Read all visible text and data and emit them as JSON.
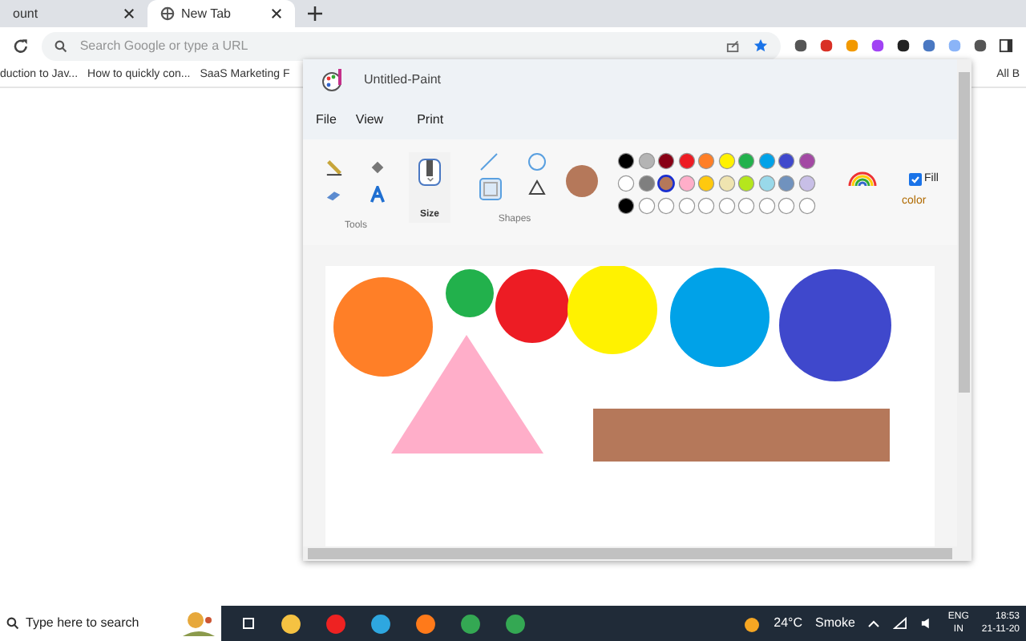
{
  "tabs": [
    {
      "label": "ount",
      "selected": false
    },
    {
      "label": "New Tab",
      "selected": true
    }
  ],
  "address_bar": {
    "placeholder": "Search Google or type a URL"
  },
  "bookmarks": [
    "duction to Jav...",
    "How to quickly con...",
    "SaaS Marketing F",
    "All B"
  ],
  "popup": {
    "title": "Untitled-Paint",
    "menu": [
      "File",
      "View",
      "Print"
    ],
    "groups": [
      "Tools",
      "Size",
      "Shapes"
    ],
    "palette": [
      [
        {
          "color": "#000000",
          "selected": false
        },
        {
          "color": "#b4b4b4",
          "selected": false
        },
        {
          "color": "#880015",
          "selected": false
        },
        {
          "color": "#ed1c24",
          "selected": false
        },
        {
          "color": "#ff7f27",
          "selected": false
        },
        {
          "color": "#fff200",
          "selected": false
        },
        {
          "color": "#22b14c",
          "selected": false
        },
        {
          "color": "#00a2e8",
          "selected": false
        },
        {
          "color": "#3f48cc",
          "selected": false
        },
        {
          "color": "#a349a4",
          "selected": false
        }
      ],
      [
        {
          "color": "#ffffff",
          "selected": false
        },
        {
          "color": "#7f7f7f",
          "selected": false
        },
        {
          "color": "#b5785a",
          "selected": true
        },
        {
          "color": "#ffaec9",
          "selected": false
        },
        {
          "color": "#ffc90e",
          "selected": false
        },
        {
          "color": "#efe4b0",
          "selected": false
        },
        {
          "color": "#b5e61d",
          "selected": false
        },
        {
          "color": "#99d9ea",
          "selected": false
        },
        {
          "color": "#7092be",
          "selected": false
        },
        {
          "color": "#c8bfe7",
          "selected": false
        }
      ],
      [
        {
          "color": "#000000",
          "selected": false
        },
        {
          "color": "#ffffff",
          "selected": false
        },
        {
          "color": "#ffffff",
          "selected": false
        },
        {
          "color": "#ffffff",
          "selected": false
        },
        {
          "color": "#ffffff",
          "selected": false
        },
        {
          "color": "#ffffff",
          "selected": false
        },
        {
          "color": "#ffffff",
          "selected": false
        },
        {
          "color": "#ffffff",
          "selected": false
        },
        {
          "color": "#ffffff",
          "selected": false
        },
        {
          "color": "#ffffff",
          "selected": false
        }
      ]
    ],
    "fill": {
      "label": "Fill",
      "checked": true
    },
    "color_label": "color"
  },
  "taskbar": {
    "search_placeholder": "Type here to search",
    "temperature": "24°C",
    "weather": "Smoke",
    "language": [
      "ENG",
      "IN"
    ],
    "time": "18:53",
    "date": "21-11-20"
  }
}
